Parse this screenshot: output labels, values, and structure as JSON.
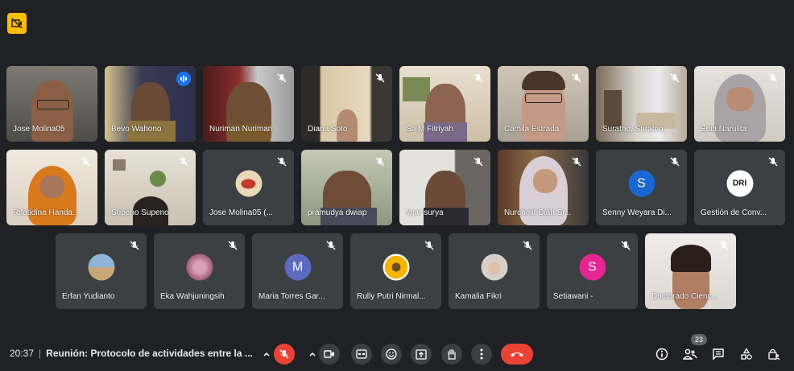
{
  "participants_row1": [
    {
      "name": "Jose Molina05",
      "muted": false,
      "speaking": false
    },
    {
      "name": "Bevo Wahono",
      "muted": false,
      "speaking": true
    },
    {
      "name": "Nuriman Nuriman",
      "muted": true,
      "speaking": false
    },
    {
      "name": "Diana Soto",
      "muted": true,
      "speaking": false
    },
    {
      "name": "Sri M Fitriyah",
      "muted": true,
      "speaking": false
    },
    {
      "name": "Camila Estrada",
      "muted": true,
      "speaking": false
    },
    {
      "name": "Suratno, Suratno,",
      "muted": true,
      "speaking": false
    },
    {
      "name": "Erlia Narulita",
      "muted": true,
      "speaking": false
    }
  ],
  "participants_row2": [
    {
      "name": "Rifatidina Handa...",
      "muted": true
    },
    {
      "name": "Supeno Supeno",
      "muted": true
    },
    {
      "name": "Jose Molina05 (...",
      "muted": true
    },
    {
      "name": "pramudya dwiap",
      "muted": true
    },
    {
      "name": "fajar surya",
      "muted": true
    },
    {
      "name": "Nurcholif Diah Sr...",
      "muted": true
    },
    {
      "name": "Senny Weyara Di...",
      "muted": true,
      "avatar_letter": "S",
      "avatar_color": "#1967d2"
    },
    {
      "name": "Gestión de Conv...",
      "muted": true,
      "avatar_text": "DRI"
    }
  ],
  "participants_row3": [
    {
      "name": "Erfan Yudianto",
      "muted": true
    },
    {
      "name": "Eka Wahjuningsih",
      "muted": true
    },
    {
      "name": "Maria Torres Gar...",
      "muted": true,
      "avatar_letter": "M",
      "avatar_color": "#5c6bc0"
    },
    {
      "name": "Rully Putri Nirmal...",
      "muted": true
    },
    {
      "name": "Kamalia Fikri",
      "muted": true
    },
    {
      "name": "Setiawani -",
      "muted": true,
      "avatar_letter": "S",
      "avatar_color": "#e52592"
    },
    {
      "name": "Doctorado Cienc...",
      "muted": true
    }
  ],
  "bottom_bar": {
    "time": "20:37",
    "separator": "|",
    "meeting_title": "Reunión: Protocolo de actividades entre la ...",
    "people_count": "23"
  },
  "colors": {
    "background": "#202124",
    "tile": "#3c4043",
    "hangup": "#ea4335",
    "accent": "#1a73e8",
    "badge": "#fbbc04"
  }
}
